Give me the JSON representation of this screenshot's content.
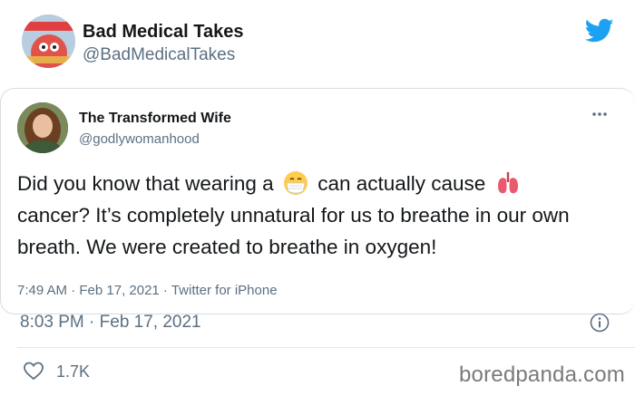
{
  "outer_tweet": {
    "display_name": "Bad Medical Takes",
    "handle": "@BadMedicalTakes",
    "timestamp": "8:03 PM · Feb 17, 2021",
    "likes": "1.7K",
    "avatar_icon": "zoidberg-doctor-avatar"
  },
  "quoted_tweet": {
    "display_name": "The Transformed Wife",
    "handle": "@godlywomanhood",
    "text_part1": "Did you know that wearing a",
    "text_part2": "can actually cause",
    "text_part3": "cancer? It’s completely unnatural for us to breathe in our own breath. We were created to breathe in oxygen!",
    "meta": "7:49 AM · Feb 17, 2021 · Twitter for iPhone",
    "emoji_1": "face-with-medical-mask",
    "emoji_2": "lungs"
  },
  "watermark": "boredpanda.com",
  "colors": {
    "twitter_blue": "#1da1f2",
    "text_primary": "#14171a",
    "text_secondary": "#5b7083",
    "border": "#d7dde2"
  }
}
